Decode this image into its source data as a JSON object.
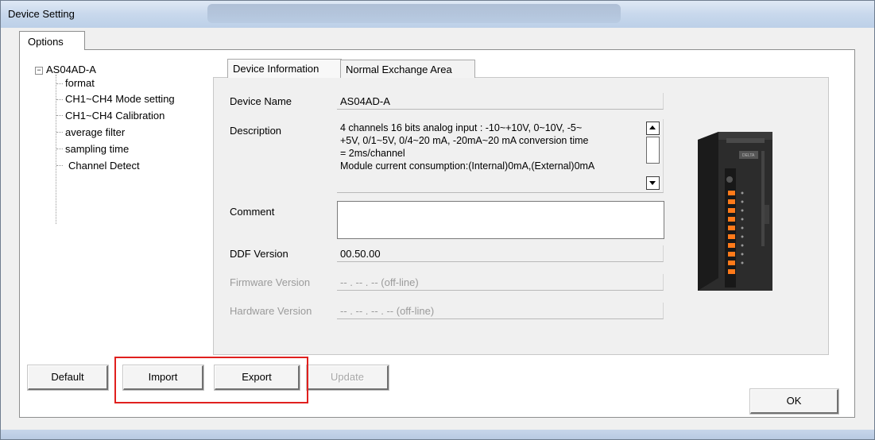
{
  "window": {
    "title": "Device Setting"
  },
  "options_tab": {
    "label": "Options"
  },
  "tree": {
    "root": "AS04AD-A",
    "items": [
      "format",
      "CH1~CH4 Mode setting",
      "CH1~CH4 Calibration",
      "average filter",
      "sampling time",
      "Channel Detect"
    ]
  },
  "tabs": {
    "device_info": "Device Information",
    "normal_exchange": "Normal Exchange Area"
  },
  "fields": {
    "device_name": {
      "label": "Device Name",
      "value": "AS04AD-A"
    },
    "description": {
      "label": "Description",
      "lines": [
        "4 channels 16 bits analog input : -10~+10V, 0~10V, -5~",
        "+5V, 0/1~5V, 0/4~20 mA, -20mA~20 mA conversion time",
        "= 2ms/channel",
        "Module current consumption:(Internal)0mA,(External)0mA"
      ]
    },
    "comment": {
      "label": "Comment",
      "value": ""
    },
    "ddf_version": {
      "label": "DDF Version",
      "value": "00.50.00"
    },
    "firmware_version": {
      "label": "Firmware Version",
      "value": "-- . -- . -- (off-line)"
    },
    "hardware_version": {
      "label": "Hardware Version",
      "value": "-- . -- . -- . -- (off-line)"
    }
  },
  "device_image": {
    "brand_mark": "DELTA"
  },
  "buttons": {
    "default": "Default",
    "import": "Import",
    "export": "Export",
    "update": "Update",
    "ok": "OK"
  },
  "colors": {
    "highlight_box": "#e0201e",
    "title_bar": "#c8d8ec"
  }
}
